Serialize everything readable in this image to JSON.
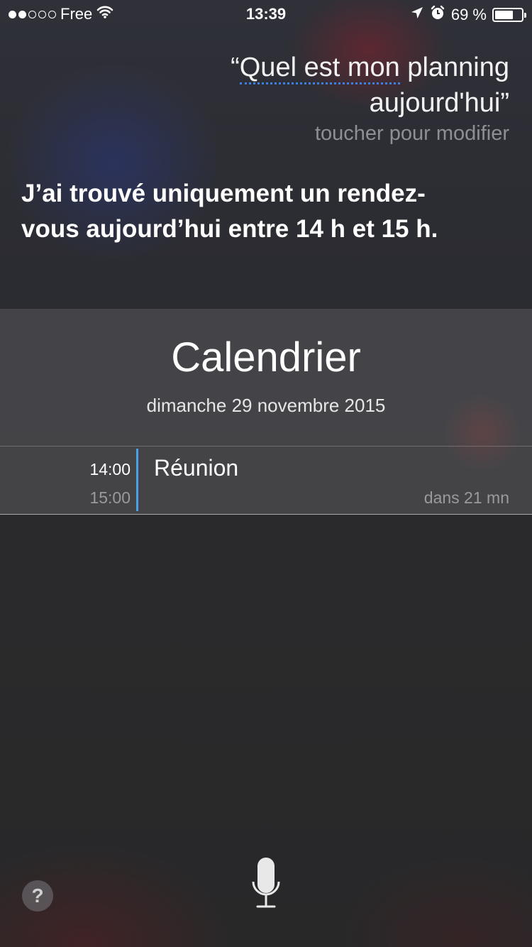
{
  "status_bar": {
    "carrier": "Free",
    "time": "13:39",
    "battery_percent": "69 %",
    "battery_level": 0.69,
    "signal_bars_filled": 2,
    "signal_bars_total": 5,
    "icons": [
      "wifi-icon",
      "location-icon",
      "alarm-icon",
      "battery-icon"
    ]
  },
  "siri": {
    "query_underlined": "Quel est mon",
    "query_rest_line1": " planning",
    "query_line2": "aujourd'hui",
    "open_quote": "“",
    "close_quote": "”",
    "edit_hint": "toucher pour modifier",
    "answer": "J’ai trouvé uniquement un rendez-vous aujourd’hui entre 14 h et 15 h."
  },
  "calendar": {
    "title": "Calendrier",
    "date": "dimanche 29 novembre 2015",
    "events": [
      {
        "start": "14:00",
        "end": "15:00",
        "title": "Réunion",
        "relative": "dans 21 mn"
      }
    ],
    "accent_color": "#4aa3e6"
  },
  "bottom": {
    "help_label": "?",
    "mic_icon": "microphone-icon"
  }
}
